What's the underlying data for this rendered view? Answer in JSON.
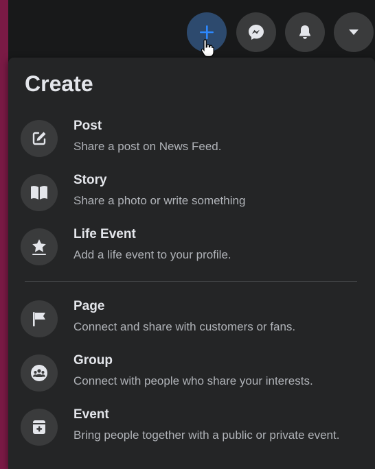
{
  "menu": {
    "title": "Create",
    "items": [
      {
        "label": "Post",
        "description": "Share a post on News Feed.",
        "icon": "compose-icon"
      },
      {
        "label": "Story",
        "description": "Share a photo or write something",
        "icon": "book-icon"
      },
      {
        "label": "Life Event",
        "description": "Add a life event to your profile.",
        "icon": "star-icon"
      },
      {
        "label": "Page",
        "description": "Connect and share with customers or fans.",
        "icon": "flag-icon"
      },
      {
        "label": "Group",
        "description": "Connect with people who share your interests.",
        "icon": "group-icon"
      },
      {
        "label": "Event",
        "description": "Bring people together with a public or private event.",
        "icon": "calendar-icon"
      }
    ]
  },
  "topbar": {
    "buttons": [
      "plus-icon",
      "messenger-icon",
      "bell-icon",
      "caret-down-icon"
    ]
  },
  "colors": {
    "background": "#18191a",
    "menu_background": "#242526",
    "icon_circle": "#3a3b3c",
    "active_button": "#2d4a6e",
    "accent_blue": "#2d88ff",
    "primary_text": "#e4e6eb",
    "secondary_text": "#b0b3b8"
  }
}
